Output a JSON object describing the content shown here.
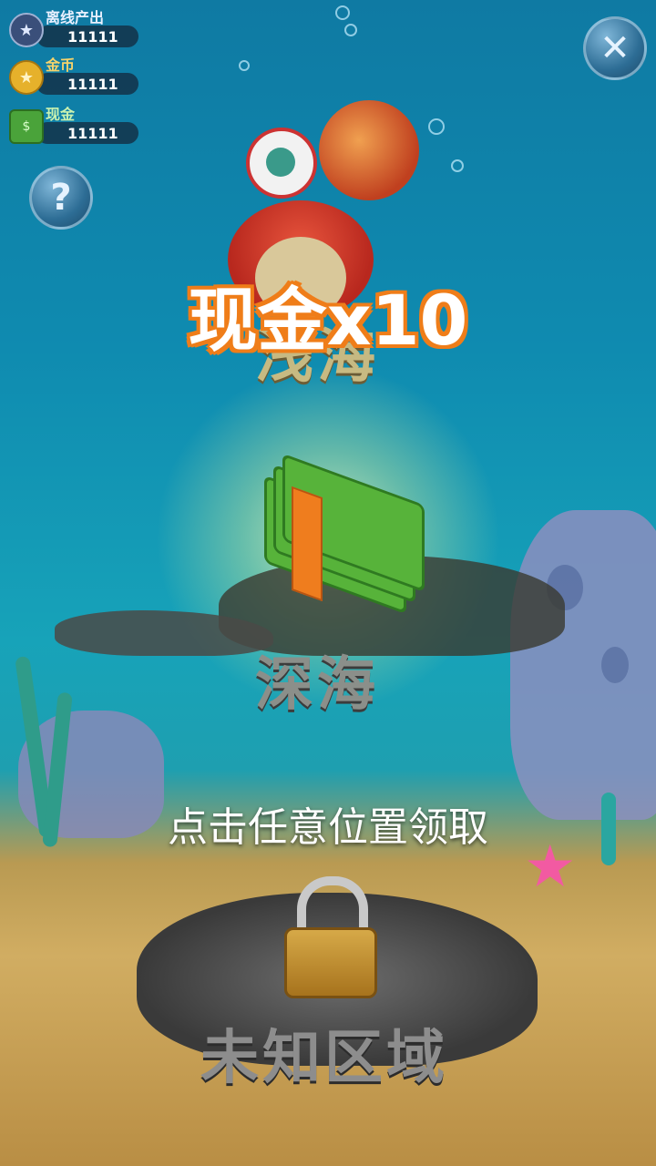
{
  "hud": {
    "offline_label": "离线产出",
    "offline_value": "11111",
    "coin_label": "金币",
    "coin_value": "11111",
    "cash_label": "现金",
    "cash_value": "11111"
  },
  "buttons": {
    "close_icon": "close-icon",
    "help_icon": "help-icon",
    "close_glyph": "✕",
    "help_glyph": "?"
  },
  "areas": {
    "shallow": "浅海",
    "deep": "深海",
    "unknown": "未知区域"
  },
  "reward": {
    "text": "现金x10"
  },
  "hint": "点击任意位置领取",
  "colors": {
    "reward_outline": "#ef7d19",
    "water_top": "#0f7aa3",
    "sand": "#d1ad62"
  }
}
